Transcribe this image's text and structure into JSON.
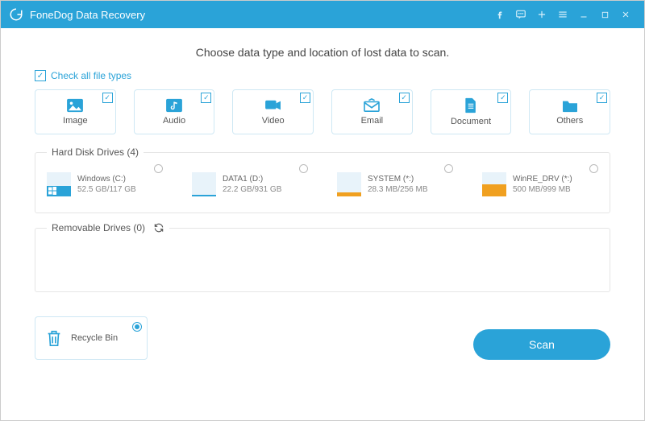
{
  "titlebar": {
    "title": "FoneDog Data Recovery"
  },
  "heading": "Choose data type and location of lost data to scan.",
  "check_all_label": "Check all file types",
  "types": [
    {
      "label": "Image"
    },
    {
      "label": "Audio"
    },
    {
      "label": "Video"
    },
    {
      "label": "Email"
    },
    {
      "label": "Document"
    },
    {
      "label": "Others"
    }
  ],
  "hdd": {
    "legend": "Hard Disk Drives (4)",
    "drives": [
      {
        "name": "Windows (C:)",
        "size": "52.5 GB/117 GB",
        "fill_pct": 45,
        "accent": "#2aa3d8",
        "win": true
      },
      {
        "name": "DATA1 (D:)",
        "size": "22.2 GB/931 GB",
        "fill_pct": 8,
        "accent": "#2aa3d8",
        "win": false
      },
      {
        "name": "SYSTEM (*:)",
        "size": "28.3 MB/256 MB",
        "fill_pct": 18,
        "accent": "#f0a020",
        "win": false
      },
      {
        "name": "WinRE_DRV (*:)",
        "size": "500 MB/999 MB",
        "fill_pct": 50,
        "accent": "#f0a020",
        "win": false
      }
    ]
  },
  "removable": {
    "legend": "Removable Drives (0)"
  },
  "recycle": {
    "label": "Recycle Bin"
  },
  "scan_label": "Scan"
}
